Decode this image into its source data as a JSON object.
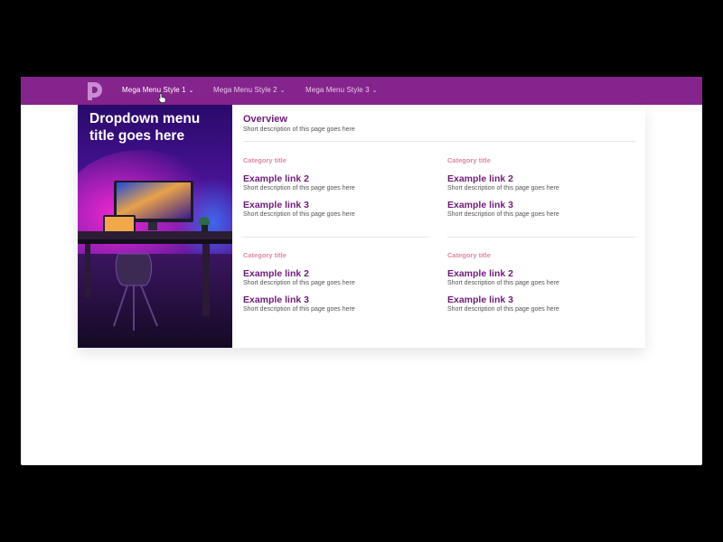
{
  "nav": {
    "items": [
      {
        "label": "Mega Menu Style 1"
      },
      {
        "label": "Mega Menu Style 2"
      },
      {
        "label": "Mega Menu Style 3"
      }
    ],
    "chevron": "⌄",
    "logo_icon": "logo-d-icon",
    "brand_color": "#86248d"
  },
  "dropdown": {
    "hero_title": "Dropdown menu title goes here",
    "overview": {
      "title": "Overview",
      "description": "Short description of this page goes here"
    },
    "categories": [
      {
        "title": "Category title",
        "links": [
          {
            "title": "Example link 2",
            "description": "Short description of this page goes here"
          },
          {
            "title": "Example link 3",
            "description": "Short description of this page goes here"
          }
        ]
      },
      {
        "title": "Category title",
        "links": [
          {
            "title": "Example link 2",
            "description": "Short description of this page goes here"
          },
          {
            "title": "Example link 3",
            "description": "Short description of this page goes here"
          }
        ]
      },
      {
        "title": "Category title",
        "links": [
          {
            "title": "Example link 2",
            "description": "Short description of this page goes here"
          },
          {
            "title": "Example link 3",
            "description": "Short description of this page goes here"
          }
        ]
      },
      {
        "title": "Category title",
        "links": [
          {
            "title": "Example link 2",
            "description": "Short description of this page goes here"
          },
          {
            "title": "Example link 3",
            "description": "Short description of this page goes here"
          }
        ]
      }
    ],
    "colors": {
      "link_title": "#6e1b78",
      "category_title": "#e087a6"
    }
  }
}
